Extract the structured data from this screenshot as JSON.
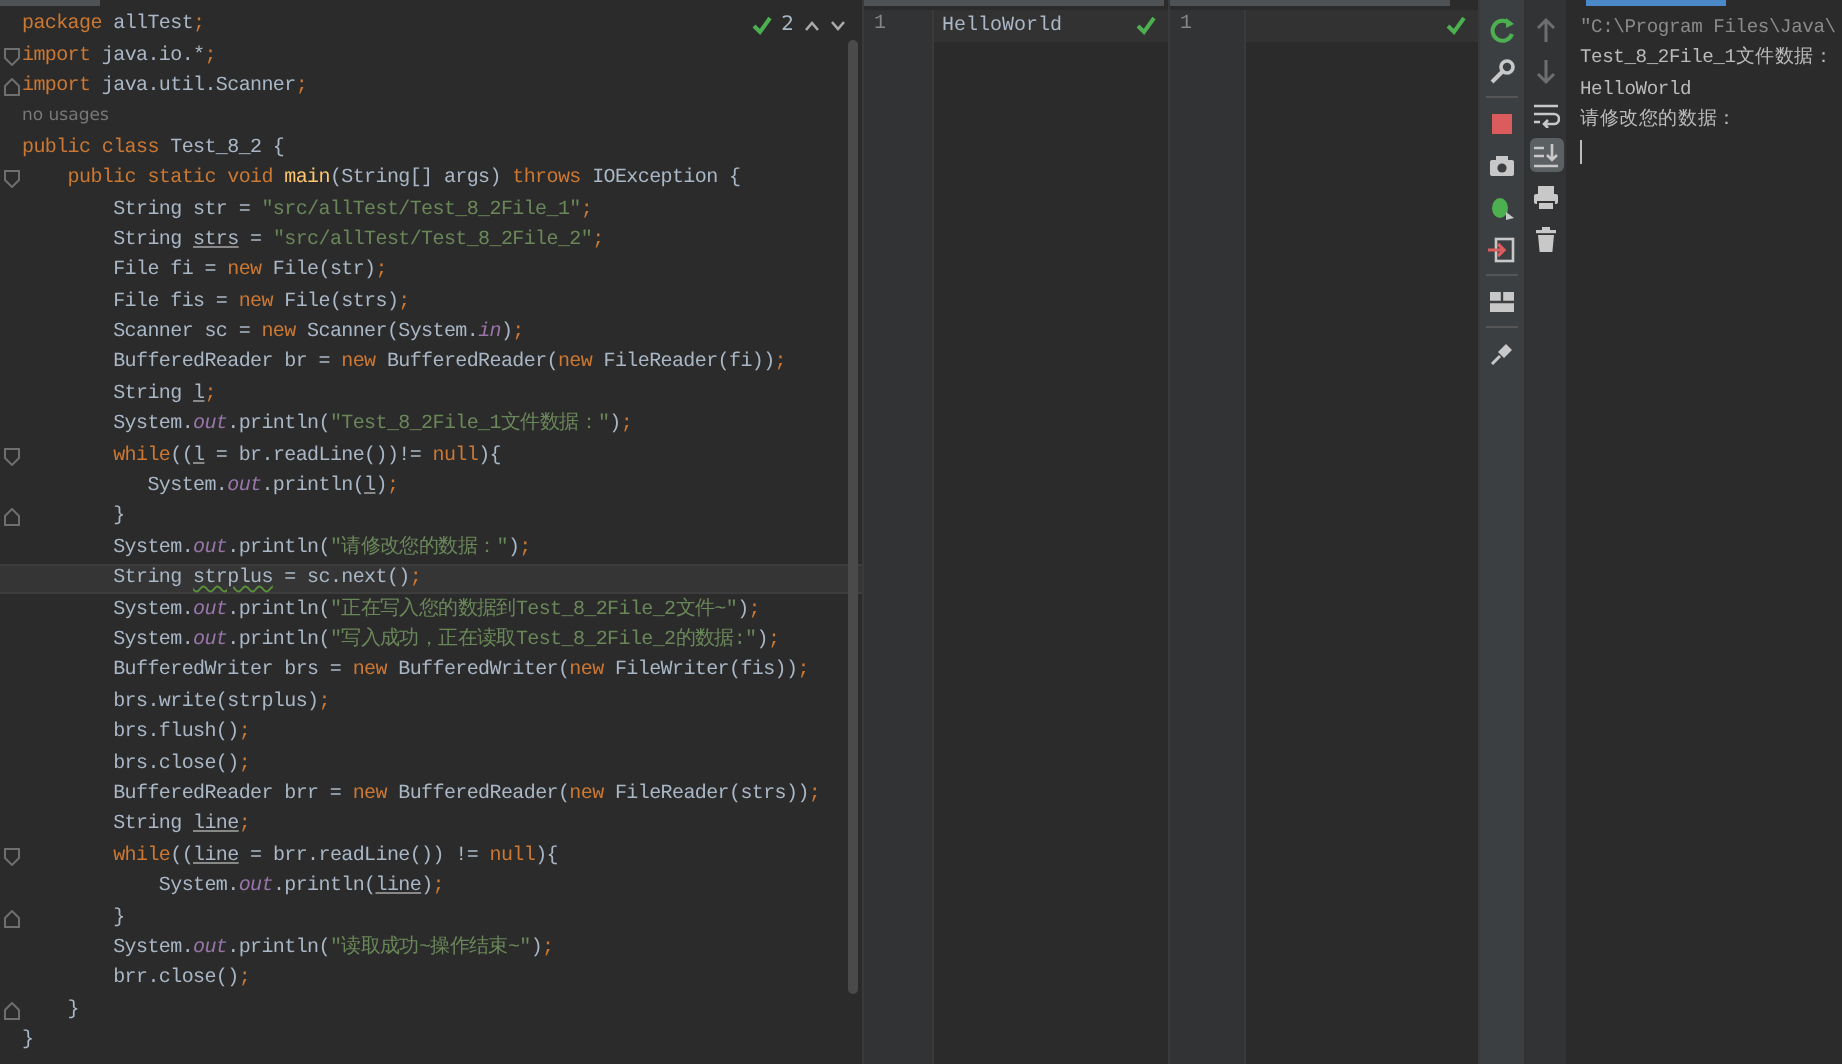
{
  "editor": {
    "tab_edge": {
      "selected": false
    },
    "inspections": {
      "count": "2"
    },
    "lines": [
      {
        "kind": "plain",
        "current": false,
        "tokens": [
          {
            "text": "package",
            "kind": "keyword"
          },
          {
            "text": " allTest",
            "kind": "plain"
          },
          {
            "text": ";",
            "kind": "punct"
          }
        ]
      },
      {
        "kind": "fold-start",
        "current": false,
        "tokens": [
          {
            "text": "import",
            "kind": "keyword"
          },
          {
            "text": " java.io.*",
            "kind": "plain"
          },
          {
            "text": ";",
            "kind": "punct"
          }
        ]
      },
      {
        "kind": "fold-end",
        "current": false,
        "tokens": [
          {
            "text": "import",
            "kind": "keyword"
          },
          {
            "text": " java.util.Scanner",
            "kind": "plain"
          },
          {
            "text": ";",
            "kind": "punct"
          }
        ]
      },
      {
        "kind": "hint",
        "current": false,
        "tokens": [
          {
            "text": "no usages",
            "kind": "hint"
          }
        ]
      },
      {
        "kind": "plain",
        "current": false,
        "tokens": [
          {
            "text": "public class",
            "kind": "keyword"
          },
          {
            "text": " Test_8_2 {",
            "kind": "plain"
          }
        ]
      },
      {
        "kind": "fold-start",
        "current": false,
        "tokens": [
          {
            "text": "    public static void",
            "kind": "keyword"
          },
          {
            "text": " main",
            "kind": "decl"
          },
          {
            "text": "(String[] args) ",
            "kind": "plain"
          },
          {
            "text": "throws",
            "kind": "keyword"
          },
          {
            "text": " IOException {",
            "kind": "plain"
          }
        ]
      },
      {
        "kind": "plain",
        "current": false,
        "tokens": [
          {
            "text": "        String str = ",
            "kind": "plain"
          },
          {
            "text": "\"src/allTest/Test_8_2File_1\"",
            "kind": "string"
          },
          {
            "text": ";",
            "kind": "punct"
          }
        ]
      },
      {
        "kind": "plain",
        "current": false,
        "tokens": [
          {
            "text": "        String ",
            "kind": "plain"
          },
          {
            "text": "strs",
            "kind": "underlined"
          },
          {
            "text": " = ",
            "kind": "plain"
          },
          {
            "text": "\"src/allTest/Test_8_2File_2\"",
            "kind": "string"
          },
          {
            "text": ";",
            "kind": "punct"
          }
        ]
      },
      {
        "kind": "plain",
        "current": false,
        "tokens": [
          {
            "text": "        File fi = ",
            "kind": "plain"
          },
          {
            "text": "new",
            "kind": "keyword"
          },
          {
            "text": " File(str)",
            "kind": "plain"
          },
          {
            "text": ";",
            "kind": "punct"
          }
        ]
      },
      {
        "kind": "plain",
        "current": false,
        "tokens": [
          {
            "text": "        File fis = ",
            "kind": "plain"
          },
          {
            "text": "new",
            "kind": "keyword"
          },
          {
            "text": " File(strs)",
            "kind": "plain"
          },
          {
            "text": ";",
            "kind": "punct"
          }
        ]
      },
      {
        "kind": "plain",
        "current": false,
        "tokens": [
          {
            "text": "        Scanner sc = ",
            "kind": "plain"
          },
          {
            "text": "new",
            "kind": "keyword"
          },
          {
            "text": " Scanner(System.",
            "kind": "plain"
          },
          {
            "text": "in",
            "kind": "static"
          },
          {
            "text": ")",
            "kind": "plain"
          },
          {
            "text": ";",
            "kind": "punct"
          }
        ]
      },
      {
        "kind": "plain",
        "current": false,
        "tokens": [
          {
            "text": "        BufferedReader br = ",
            "kind": "plain"
          },
          {
            "text": "new",
            "kind": "keyword"
          },
          {
            "text": " BufferedReader(",
            "kind": "plain"
          },
          {
            "text": "new",
            "kind": "keyword"
          },
          {
            "text": " FileReader(fi))",
            "kind": "plain"
          },
          {
            "text": ";",
            "kind": "punct"
          }
        ]
      },
      {
        "kind": "plain",
        "current": false,
        "tokens": [
          {
            "text": "        String ",
            "kind": "plain"
          },
          {
            "text": "l",
            "kind": "underlined"
          },
          {
            "text": ";",
            "kind": "punct"
          }
        ]
      },
      {
        "kind": "plain",
        "current": false,
        "tokens": [
          {
            "text": "        System.",
            "kind": "plain"
          },
          {
            "text": "out",
            "kind": "static"
          },
          {
            "text": ".println(",
            "kind": "plain"
          },
          {
            "text": "\"Test_8_2File_1文件数据：\"",
            "kind": "string"
          },
          {
            "text": ")",
            "kind": "plain"
          },
          {
            "text": ";",
            "kind": "punct"
          }
        ]
      },
      {
        "kind": "fold-start",
        "current": false,
        "tokens": [
          {
            "text": "        while",
            "kind": "keyword"
          },
          {
            "text": "((",
            "kind": "plain"
          },
          {
            "text": "l",
            "kind": "underlined"
          },
          {
            "text": " = br.readLine())!= ",
            "kind": "plain"
          },
          {
            "text": "null",
            "kind": "keyword"
          },
          {
            "text": "){",
            "kind": "plain"
          }
        ]
      },
      {
        "kind": "plain",
        "current": false,
        "tokens": [
          {
            "text": "           System.",
            "kind": "plain"
          },
          {
            "text": "out",
            "kind": "static"
          },
          {
            "text": ".println(",
            "kind": "plain"
          },
          {
            "text": "l",
            "kind": "underlined"
          },
          {
            "text": ")",
            "kind": "plain"
          },
          {
            "text": ";",
            "kind": "punct"
          }
        ]
      },
      {
        "kind": "fold-end",
        "current": false,
        "tokens": [
          {
            "text": "        }",
            "kind": "plain"
          }
        ]
      },
      {
        "kind": "plain",
        "current": false,
        "tokens": [
          {
            "text": "        System.",
            "kind": "plain"
          },
          {
            "text": "out",
            "kind": "static"
          },
          {
            "text": ".println(",
            "kind": "plain"
          },
          {
            "text": "\"请修改您的数据：\"",
            "kind": "string"
          },
          {
            "text": ")",
            "kind": "plain"
          },
          {
            "text": ";",
            "kind": "punct"
          }
        ]
      },
      {
        "kind": "plain",
        "current": true,
        "tokens": [
          {
            "text": "        String ",
            "kind": "plain"
          },
          {
            "text": "strplus",
            "kind": "warning"
          },
          {
            "text": " = sc.next()",
            "kind": "plain"
          },
          {
            "text": ";",
            "kind": "punct"
          }
        ]
      },
      {
        "kind": "plain",
        "current": false,
        "tokens": [
          {
            "text": "        System.",
            "kind": "plain"
          },
          {
            "text": "out",
            "kind": "static"
          },
          {
            "text": ".println(",
            "kind": "plain"
          },
          {
            "text": "\"正在写入您的数据到Test_8_2File_2文件~\"",
            "kind": "string"
          },
          {
            "text": ")",
            "kind": "plain"
          },
          {
            "text": ";",
            "kind": "punct"
          }
        ]
      },
      {
        "kind": "plain",
        "current": false,
        "tokens": [
          {
            "text": "        System.",
            "kind": "plain"
          },
          {
            "text": "out",
            "kind": "static"
          },
          {
            "text": ".println(",
            "kind": "plain"
          },
          {
            "text": "\"写入成功，正在读取Test_8_2File_2的数据:\"",
            "kind": "string"
          },
          {
            "text": ")",
            "kind": "plain"
          },
          {
            "text": ";",
            "kind": "punct"
          }
        ]
      },
      {
        "kind": "plain",
        "current": false,
        "tokens": [
          {
            "text": "        BufferedWriter brs = ",
            "kind": "plain"
          },
          {
            "text": "new",
            "kind": "keyword"
          },
          {
            "text": " BufferedWriter(",
            "kind": "plain"
          },
          {
            "text": "new",
            "kind": "keyword"
          },
          {
            "text": " FileWriter(fis))",
            "kind": "plain"
          },
          {
            "text": ";",
            "kind": "punct"
          }
        ]
      },
      {
        "kind": "plain",
        "current": false,
        "tokens": [
          {
            "text": "        brs.write(strplus)",
            "kind": "plain"
          },
          {
            "text": ";",
            "kind": "punct"
          }
        ]
      },
      {
        "kind": "plain",
        "current": false,
        "tokens": [
          {
            "text": "        brs.flush()",
            "kind": "plain"
          },
          {
            "text": ";",
            "kind": "punct"
          }
        ]
      },
      {
        "kind": "plain",
        "current": false,
        "tokens": [
          {
            "text": "        brs.close()",
            "kind": "plain"
          },
          {
            "text": ";",
            "kind": "punct"
          }
        ]
      },
      {
        "kind": "plain",
        "current": false,
        "tokens": [
          {
            "text": "        BufferedReader brr = ",
            "kind": "plain"
          },
          {
            "text": "new",
            "kind": "keyword"
          },
          {
            "text": " BufferedReader(",
            "kind": "plain"
          },
          {
            "text": "new",
            "kind": "keyword"
          },
          {
            "text": " FileReader(strs))",
            "kind": "plain"
          },
          {
            "text": ";",
            "kind": "punct"
          }
        ]
      },
      {
        "kind": "plain",
        "current": false,
        "tokens": [
          {
            "text": "        String ",
            "kind": "plain"
          },
          {
            "text": "line",
            "kind": "underlined"
          },
          {
            "text": ";",
            "kind": "punct"
          }
        ]
      },
      {
        "kind": "fold-start",
        "current": false,
        "tokens": [
          {
            "text": "        while",
            "kind": "keyword"
          },
          {
            "text": "((",
            "kind": "plain"
          },
          {
            "text": "line",
            "kind": "underlined"
          },
          {
            "text": " = brr.readLine()) != ",
            "kind": "plain"
          },
          {
            "text": "null",
            "kind": "keyword"
          },
          {
            "text": "){",
            "kind": "plain"
          }
        ]
      },
      {
        "kind": "plain",
        "current": false,
        "tokens": [
          {
            "text": "            System.",
            "kind": "plain"
          },
          {
            "text": "out",
            "kind": "static"
          },
          {
            "text": ".println(",
            "kind": "plain"
          },
          {
            "text": "line",
            "kind": "underlined"
          },
          {
            "text": ")",
            "kind": "plain"
          },
          {
            "text": ";",
            "kind": "punct"
          }
        ]
      },
      {
        "kind": "fold-end",
        "current": false,
        "tokens": [
          {
            "text": "        }",
            "kind": "plain"
          }
        ]
      },
      {
        "kind": "plain",
        "current": false,
        "tokens": [
          {
            "text": "        System.",
            "kind": "plain"
          },
          {
            "text": "out",
            "kind": "static"
          },
          {
            "text": ".println(",
            "kind": "plain"
          },
          {
            "text": "\"读取成功~操作结束~\"",
            "kind": "string"
          },
          {
            "text": ")",
            "kind": "plain"
          },
          {
            "text": ";",
            "kind": "punct"
          }
        ]
      },
      {
        "kind": "plain",
        "current": false,
        "tokens": [
          {
            "text": "        brr.close()",
            "kind": "plain"
          },
          {
            "text": ";",
            "kind": "punct"
          }
        ]
      },
      {
        "kind": "fold-end",
        "current": false,
        "tokens": [
          {
            "text": "    }",
            "kind": "plain"
          }
        ]
      },
      {
        "kind": "plain",
        "current": false,
        "tokens": [
          {
            "text": "}",
            "kind": "plain"
          }
        ]
      }
    ]
  },
  "file_panels": [
    {
      "tab_edge": {
        "selected": false
      },
      "line_number": "1",
      "text": "HelloWorld"
    },
    {
      "tab_edge": {
        "selected": false
      },
      "line_number": "1"
    }
  ],
  "console_toolbar": [
    {
      "disabled": true,
      "selected": false
    },
    {
      "disabled": true,
      "selected": false
    },
    {
      "disabled": false,
      "selected": false
    },
    {
      "disabled": false,
      "selected": true
    },
    {
      "disabled": false,
      "selected": false
    },
    {
      "disabled": false,
      "selected": false
    }
  ],
  "console": {
    "tab_edge": {
      "selected": true
    },
    "lines": [
      {
        "kind": "command",
        "text": "\"C:\\Program Files\\Java\\"
      },
      {
        "kind": "output",
        "text": "Test_8_2File_1文件数据："
      },
      {
        "kind": "output",
        "text": "HelloWorld"
      },
      {
        "kind": "output",
        "text": "请修改您的数据："
      }
    ]
  }
}
